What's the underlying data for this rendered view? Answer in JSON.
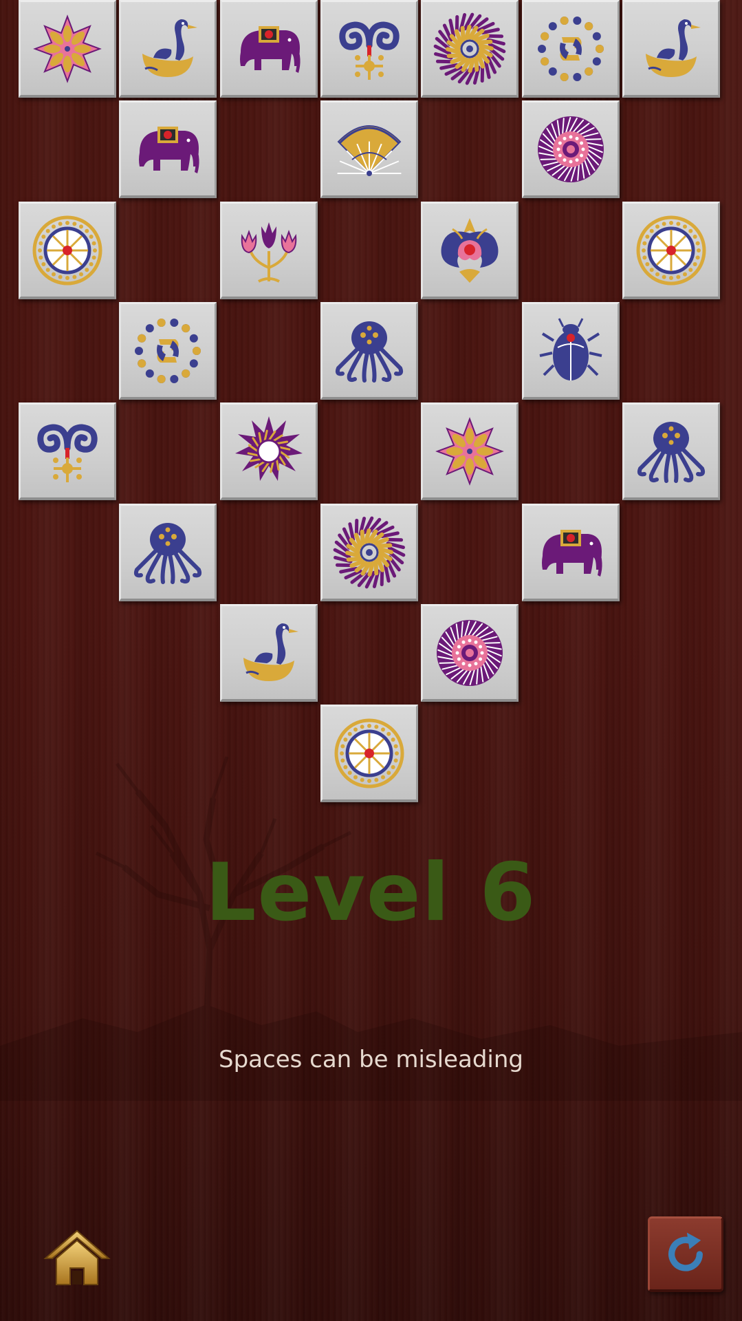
{
  "level": {
    "title": "Level 6",
    "hint": "Spaces can be misleading"
  },
  "colors": {
    "navy": "#3b3f8f",
    "purple": "#6b1a78",
    "gold": "#d9a93a",
    "pink": "#e8739a",
    "title": "#3a5a16"
  },
  "tiles": [
    {
      "id": "t1",
      "row": 0,
      "col": 0,
      "icon": "flower-icon"
    },
    {
      "id": "t2",
      "row": 0,
      "col": 1,
      "icon": "swan-icon"
    },
    {
      "id": "t3",
      "row": 0,
      "col": 2,
      "icon": "elephant-icon"
    },
    {
      "id": "t4",
      "row": 0,
      "col": 3,
      "icon": "ram-horns-icon"
    },
    {
      "id": "t5",
      "row": 0,
      "col": 4,
      "icon": "spiral-sun-icon"
    },
    {
      "id": "t6",
      "row": 0,
      "col": 5,
      "icon": "dots-ring-icon"
    },
    {
      "id": "t7",
      "row": 0,
      "col": 6,
      "icon": "swan-icon"
    },
    {
      "id": "t8",
      "row": 1,
      "col": 1,
      "icon": "elephant-icon"
    },
    {
      "id": "t9",
      "row": 1,
      "col": 3,
      "icon": "fan-icon"
    },
    {
      "id": "t10",
      "row": 1,
      "col": 5,
      "icon": "rosette-icon"
    },
    {
      "id": "t11",
      "row": 2,
      "col": 0,
      "icon": "wheel-icon"
    },
    {
      "id": "t12",
      "row": 2,
      "col": 2,
      "icon": "tulips-icon"
    },
    {
      "id": "t13",
      "row": 2,
      "col": 4,
      "icon": "lotus-icon"
    },
    {
      "id": "t14",
      "row": 2,
      "col": 6,
      "icon": "wheel-icon"
    },
    {
      "id": "t15",
      "row": 3,
      "col": 1,
      "icon": "dots-ring-icon"
    },
    {
      "id": "t16",
      "row": 3,
      "col": 3,
      "icon": "octopus-icon"
    },
    {
      "id": "t17",
      "row": 3,
      "col": 5,
      "icon": "beetle-icon"
    },
    {
      "id": "t18",
      "row": 4,
      "col": 0,
      "icon": "ram-horns-icon"
    },
    {
      "id": "t19",
      "row": 4,
      "col": 2,
      "icon": "sun-icon"
    },
    {
      "id": "t20",
      "row": 4,
      "col": 4,
      "icon": "flower-icon"
    },
    {
      "id": "t21",
      "row": 4,
      "col": 6,
      "icon": "octopus-icon"
    },
    {
      "id": "t22",
      "row": 5,
      "col": 1,
      "icon": "octopus-icon"
    },
    {
      "id": "t23",
      "row": 5,
      "col": 3,
      "icon": "spiral-sun-icon"
    },
    {
      "id": "t24",
      "row": 5,
      "col": 5,
      "icon": "elephant-icon"
    },
    {
      "id": "t25",
      "row": 6,
      "col": 2,
      "icon": "swan-icon"
    },
    {
      "id": "t26",
      "row": 6,
      "col": 4,
      "icon": "rosette-icon"
    },
    {
      "id": "t27",
      "row": 7,
      "col": 3,
      "icon": "wheel-icon"
    }
  ],
  "controls": {
    "home_icon": "home-icon",
    "restart_icon": "restart-icon"
  }
}
